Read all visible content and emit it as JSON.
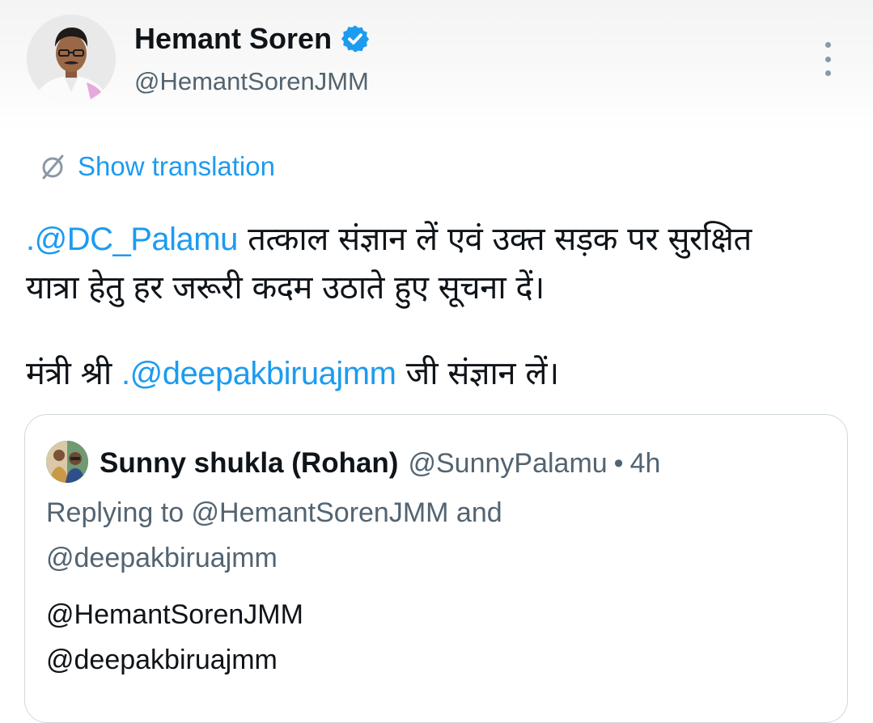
{
  "tweet": {
    "author": {
      "display_name": "Hemant Soren",
      "handle": "@HemantSorenJMM",
      "verified": true,
      "avatar_icon": "person-avatar"
    },
    "more_icon": "more-vertical-icon",
    "translation": {
      "label": "Show translation",
      "icon": "translate-icon"
    },
    "text": {
      "line1_mention": ".@DC_Palamu",
      "line1_text": " तत्काल संज्ञान लें एवं उक्त सड़क पर सुरक्षित",
      "line2_text": "यात्रा हेतु हर जरूरी कदम उठाते हुए सूचना दें।",
      "line3_prefix": "मंत्री श्री ",
      "line3_mention": ".@deepakbiruajmm",
      "line3_suffix": " जी संज्ञान लें।"
    },
    "quoted": {
      "display_name": "Sunny shukla (Rohan)",
      "handle": "@SunnyPalamu",
      "separator": "•",
      "time": "4h",
      "reply_prefix": "Replying to ",
      "reply_mention_1": "@HemantSorenJMM",
      "reply_and": " and",
      "reply_mention_2": "@deepakbiruajmm",
      "body_mention_1": "@HemantSorenJMM",
      "body_mention_2": "@deepakbiruajmm"
    }
  },
  "colors": {
    "accent": "#1d9bf0",
    "secondary_text": "#536471",
    "primary_text": "#0f1419",
    "border": "#cfd9de"
  }
}
